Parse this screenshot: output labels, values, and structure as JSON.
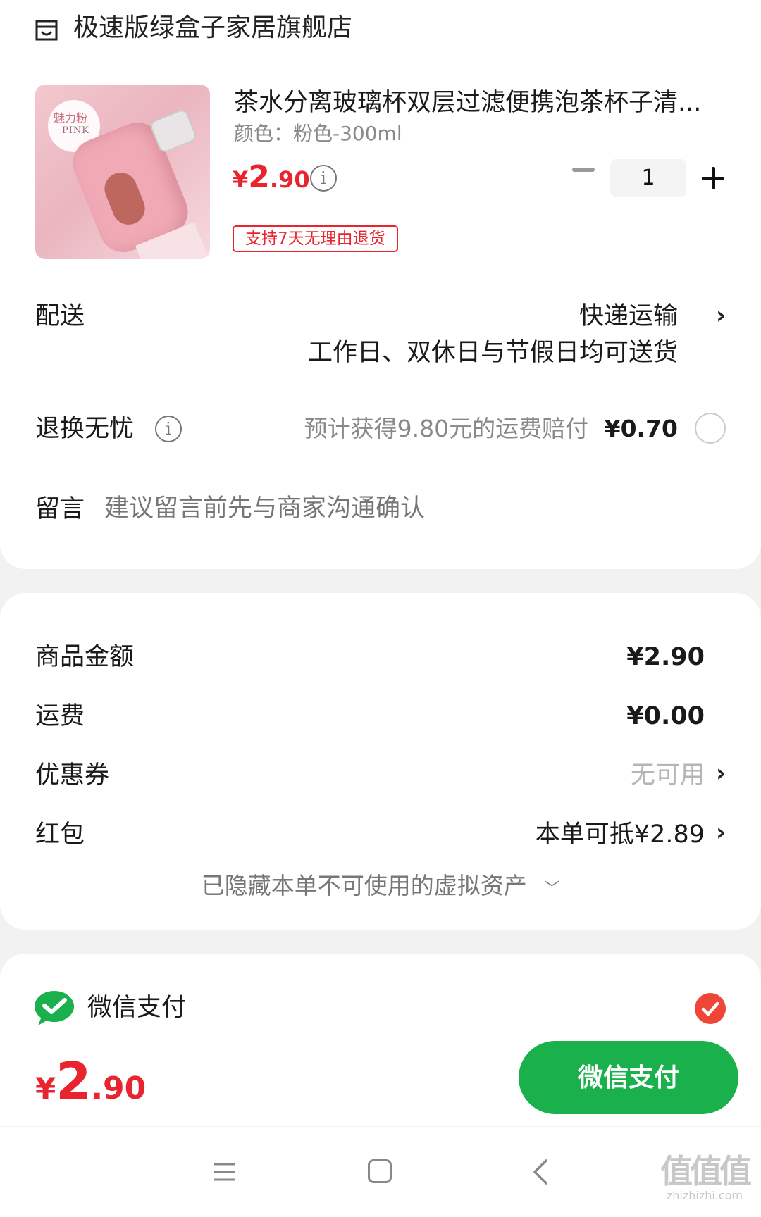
{
  "shop": {
    "name": "极速版绿盒子家居旗舰店",
    "icon": "shop-icon"
  },
  "product": {
    "image_label": "魅力粉",
    "image_sublabel": "PINK",
    "title": "茶水分离玻璃杯双层过滤便携泡茶杯子清...",
    "spec": "颜色：粉色-300ml",
    "price_currency": "¥",
    "price_int": "2",
    "price_dec": ".90",
    "quantity": "1",
    "return_badge": "支持7天无理由退货"
  },
  "delivery": {
    "label": "配送",
    "method": "快递运输",
    "note": "工作日、双休日与节假日均可送货"
  },
  "return_insurance": {
    "label": "退换无忧",
    "desc": "预计获得9.80元的运费赔付",
    "price": "¥0.70"
  },
  "message": {
    "label": "留言",
    "placeholder": "建议留言前先与商家沟通确认"
  },
  "summary": {
    "goods_label": "商品金额",
    "goods_value": "¥2.90",
    "shipping_label": "运费",
    "shipping_value": "¥0.00",
    "coupon_label": "优惠券",
    "coupon_value": "无可用",
    "redpacket_label": "红包",
    "redpacket_value": "本单可抵¥2.89",
    "hidden_assets": "已隐藏本单不可使用的虚拟资产"
  },
  "payment": {
    "method": "微信支付",
    "total_currency": "¥",
    "total_int": "2",
    "total_dec": ".90",
    "button": "微信支付"
  },
  "watermark": {
    "main": "值值值",
    "sub": "zhizhizhi.com"
  },
  "colors": {
    "price_red": "#e8242f",
    "wechat_green": "#1ab04b"
  }
}
